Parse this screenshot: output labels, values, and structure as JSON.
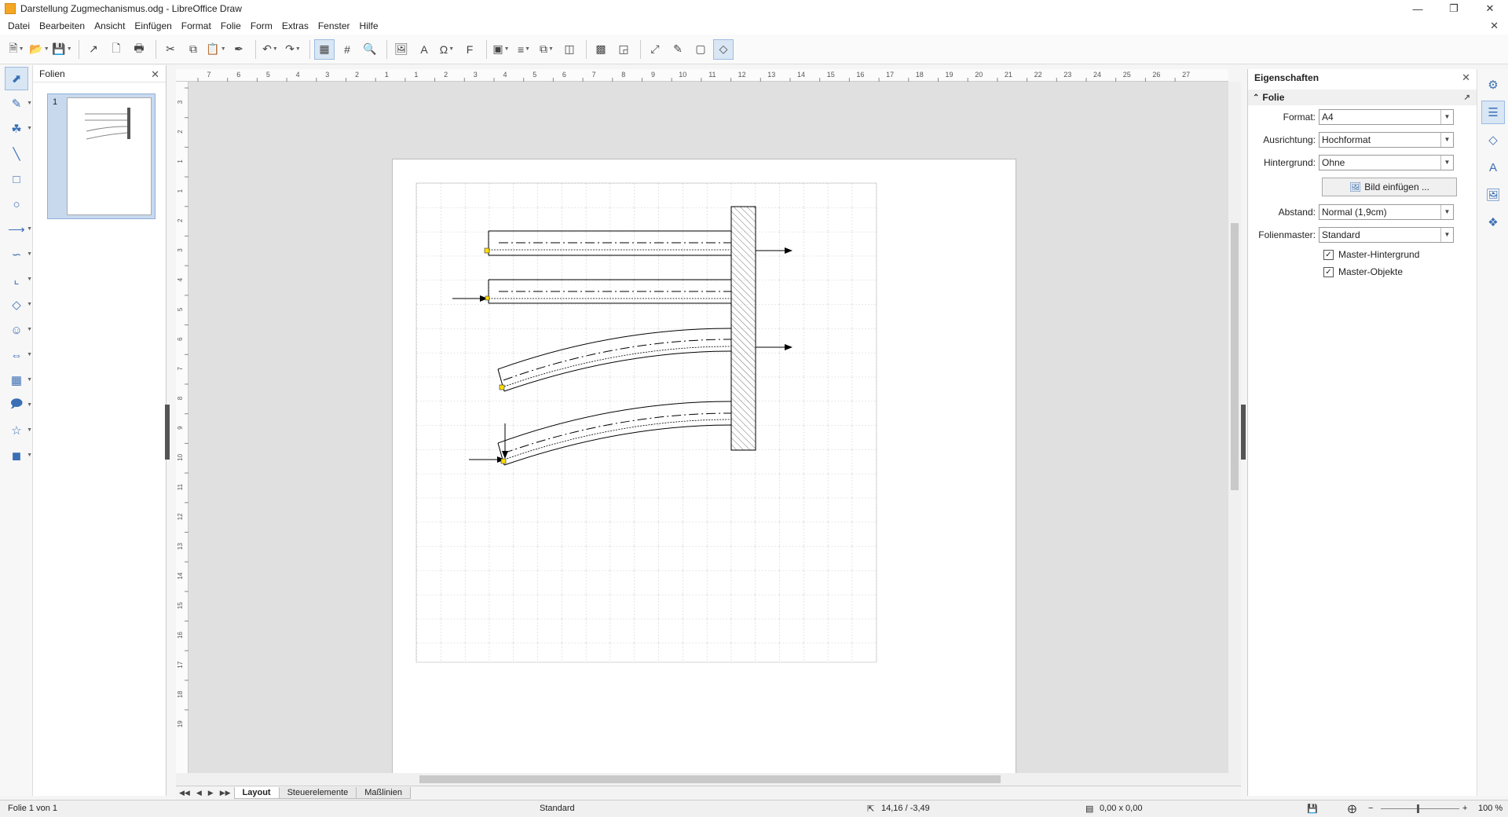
{
  "window": {
    "title": "Darstellung Zugmechanismus.odg - LibreOffice Draw",
    "controls": [
      "minimize",
      "restore",
      "close"
    ]
  },
  "menu": [
    "Datei",
    "Bearbeiten",
    "Ansicht",
    "Einfügen",
    "Format",
    "Folie",
    "Form",
    "Extras",
    "Fenster",
    "Hilfe"
  ],
  "slides_panel": {
    "title": "Folien",
    "slides": [
      {
        "number": "1"
      }
    ]
  },
  "ruler": {
    "h_ticks": [
      "7",
      "6",
      "5",
      "4",
      "3",
      "2",
      "1",
      "1",
      "2",
      "3",
      "4",
      "5",
      "6",
      "7",
      "8",
      "9",
      "10",
      "11",
      "12",
      "13",
      "14",
      "15",
      "16",
      "17",
      "18",
      "19",
      "20",
      "21",
      "22",
      "23",
      "24",
      "25",
      "26",
      "27"
    ],
    "v_ticks": [
      "3",
      "2",
      "1",
      "1",
      "2",
      "3",
      "4",
      "5",
      "6",
      "7",
      "8",
      "9",
      "10",
      "11",
      "12",
      "13",
      "14",
      "15",
      "16",
      "17",
      "18",
      "19"
    ]
  },
  "tabs": {
    "items": [
      "Layout",
      "Steuerelemente",
      "Maßlinien"
    ],
    "active": "Layout"
  },
  "sidebar": {
    "title": "Eigenschaften",
    "section": "Folie",
    "format": {
      "label": "Format:",
      "value": "A4"
    },
    "orientation": {
      "label": "Ausrichtung:",
      "value": "Hochformat"
    },
    "background": {
      "label": "Hintergrund:",
      "value": "Ohne"
    },
    "insert_image_label": "Bild einfügen ...",
    "margin": {
      "label": "Abstand:",
      "value": "Normal (1,9cm)"
    },
    "master": {
      "label": "Folienmaster:",
      "value": "Standard"
    },
    "master_background": {
      "label": "Master-Hintergrund",
      "checked": true
    },
    "master_objects": {
      "label": "Master-Objekte",
      "checked": true
    }
  },
  "status": {
    "slide": "Folie 1 von 1",
    "layout": "Standard",
    "position": "14,16 / -3,49",
    "size": "0,00 x 0,00",
    "zoom": "100 %"
  },
  "colors": {
    "accent": "#3a6fb5",
    "selection": "#d9e6f4",
    "handle": "#ffdd00"
  }
}
